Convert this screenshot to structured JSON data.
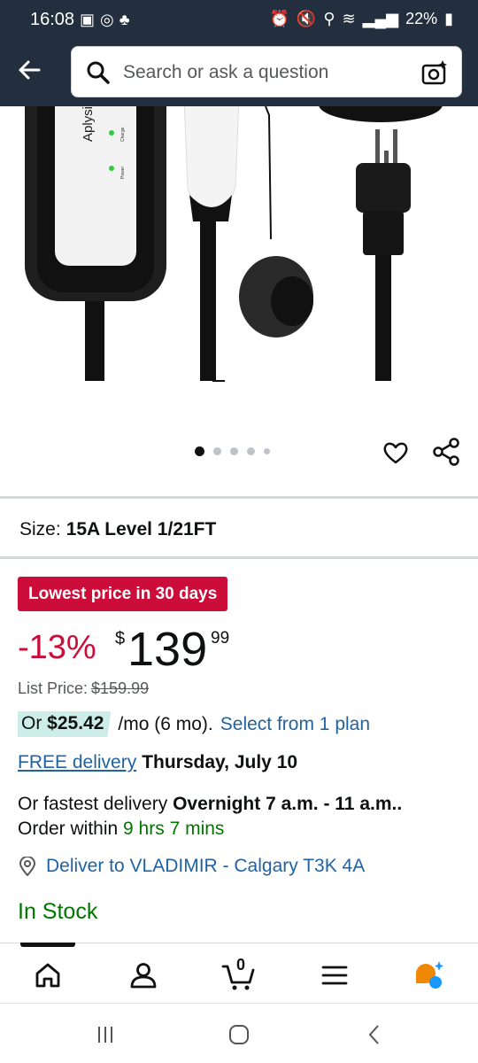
{
  "status_bar": {
    "time": "16:08",
    "battery": "22%"
  },
  "search": {
    "placeholder": "Search or ask a question"
  },
  "product_image": {
    "brand_text": "AplysiaTec",
    "indicator_charge": "Charge",
    "indicator_power": "Power",
    "total_images": 5,
    "active_image": 1
  },
  "size": {
    "label": "Size:",
    "value": "15A Level 1/21FT"
  },
  "deal_badge": "Lowest price in 30 days",
  "price": {
    "discount": "-13%",
    "currency": "$",
    "whole": "139",
    "cents": "99",
    "list_label": "List Price:",
    "list_value": "$159.99"
  },
  "installments": {
    "prefix": "Or",
    "amount": "$25.42",
    "term": "/mo (6 mo).",
    "link": "Select from 1 plan"
  },
  "delivery": {
    "link": "FREE delivery",
    "date": "Thursday, July 10"
  },
  "fastest_delivery": {
    "prefix": "Or fastest delivery",
    "window": "Overnight 7 a.m. - 11 a.m..",
    "order_prefix": "Order within",
    "countdown": "9 hrs 7 mins"
  },
  "deliver_to": "Deliver to VLADIMIR - Calgary T3K 4A",
  "stock_status": "In Stock",
  "bottom_nav": {
    "cart_count": "0"
  },
  "colors": {
    "header_bg": "#232f3e",
    "deal_red": "#cc0c39",
    "link_blue": "#2162a1",
    "stock_green": "#007600",
    "installment_bg": "#cdeee8"
  }
}
